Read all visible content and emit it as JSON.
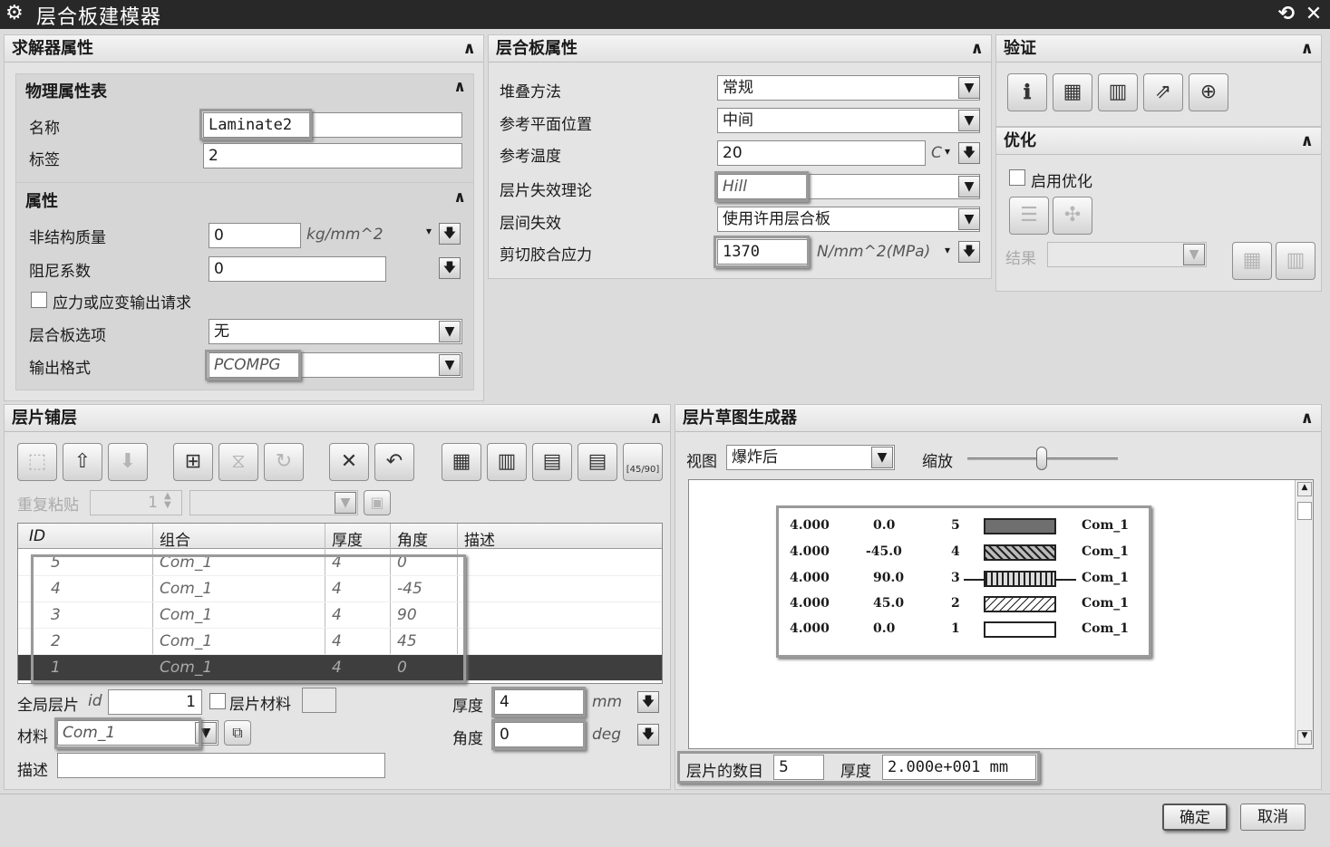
{
  "window": {
    "title": "层合板建模器",
    "restore": "⟲",
    "close": "✕"
  },
  "solver": {
    "header": "求解器属性",
    "collapse": "ʌ",
    "phys": {
      "header": "物理属性表",
      "name_label": "名称",
      "name_value": "Laminate2",
      "tag_label": "标签",
      "tag_value": "2"
    },
    "props": {
      "header": "属性",
      "nsm_label": "非结构质量",
      "nsm_value": "0",
      "nsm_unit": "kg/mm^2",
      "damp_label": "阻尼系数",
      "damp_value": "0",
      "stress_req_label": "应力或应变输出请求",
      "lam_opt_label": "层合板选项",
      "lam_opt_value": "无",
      "out_fmt_label": "输出格式",
      "out_fmt_value": "PCOMPG"
    }
  },
  "laminate": {
    "header": "层合板属性",
    "stack_label": "堆叠方法",
    "stack_value": "常规",
    "ref_plane_label": "参考平面位置",
    "ref_plane_value": "中间",
    "ref_temp_label": "参考温度",
    "ref_temp_value": "20",
    "ref_temp_unit": "C",
    "ply_fail_label": "层片失效理论",
    "ply_fail_value": "Hill",
    "inter_fail_label": "层间失效",
    "inter_fail_value": "使用许用层合板",
    "shear_label": "剪切胶合应力",
    "shear_value": "1370",
    "shear_unit": "N/mm^2(MPa)"
  },
  "verify": {
    "header": "验证"
  },
  "optimize": {
    "header": "优化",
    "enable_label": "启用优化",
    "result_label": "结果"
  },
  "plies": {
    "header": "层片铺层",
    "repeat_label": "重复粘贴",
    "repeat_value": "1",
    "icon_sym_label": "[45/90]",
    "columns": [
      "ID",
      "组合",
      "厚度",
      "角度",
      "描述"
    ],
    "rows": [
      {
        "id": "5",
        "combo": "Com_1",
        "thk": "4",
        "ang": "0"
      },
      {
        "id": "4",
        "combo": "Com_1",
        "thk": "4",
        "ang": "-45"
      },
      {
        "id": "3",
        "combo": "Com_1",
        "thk": "4",
        "ang": "90"
      },
      {
        "id": "2",
        "combo": "Com_1",
        "thk": "4",
        "ang": "45"
      },
      {
        "id": "1",
        "combo": "Com_1",
        "thk": "4",
        "ang": "0"
      }
    ],
    "global_ply_label": "全局层片",
    "global_ply_id": "id",
    "global_ply_value": "1",
    "ply_material_label": "层片材料",
    "material_label": "材料",
    "material_value": "Com_1",
    "desc_label": "描述",
    "thk_label": "厚度",
    "thk_value": "4",
    "thk_unit": "mm",
    "ang_label": "角度",
    "ang_value": "0",
    "ang_unit": "deg"
  },
  "sketch": {
    "header": "层片草图生成器",
    "view_label": "视图",
    "view_value": "爆炸后",
    "zoom_label": "缩放",
    "layers": [
      {
        "thk": "4.000",
        "ang": "0.0",
        "n": "5",
        "mat": "Com_1"
      },
      {
        "thk": "4.000",
        "ang": "-45.0",
        "n": "4",
        "mat": "Com_1"
      },
      {
        "thk": "4.000",
        "ang": "90.0",
        "n": "3",
        "mat": "Com_1"
      },
      {
        "thk": "4.000",
        "ang": "45.0",
        "n": "2",
        "mat": "Com_1"
      },
      {
        "thk": "4.000",
        "ang": "0.0",
        "n": "1",
        "mat": "Com_1"
      }
    ],
    "count_label": "层片的数目",
    "count_value": "5",
    "total_thk_label": "厚度",
    "total_thk_value": "2.000e+001 mm"
  },
  "footer": {
    "ok": "确定",
    "cancel": "取消"
  }
}
